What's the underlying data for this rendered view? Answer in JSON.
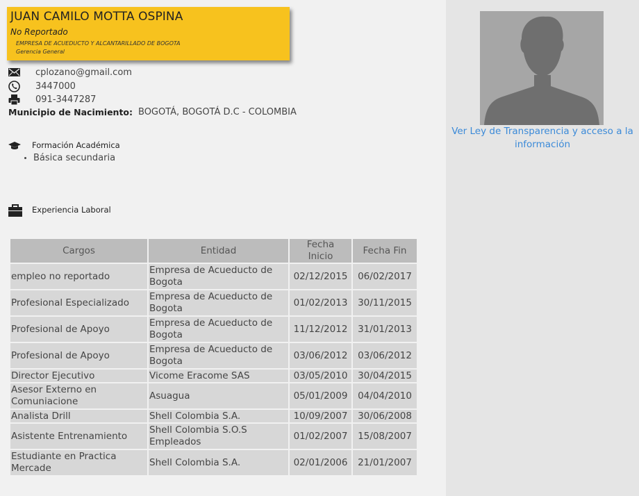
{
  "profile": {
    "name": "JUAN CAMILO MOTTA OSPINA",
    "status": "No Reportado",
    "company": "EMPRESA DE ACUEDUCTO Y ALCANTARILLADO DE BOGOTA",
    "department": "Gerencia General"
  },
  "contact": {
    "email": "cplozano@gmail.com",
    "phone": "3447000",
    "fax": "091-3447287",
    "birthplace_label": "Municipio de Nacimiento:",
    "birthplace_value": "BOGOTÁ, BOGOTÁ D.C - COLOMBIA"
  },
  "education": {
    "title": "Formación Académica",
    "items": [
      "Básica secundaria"
    ]
  },
  "experience": {
    "title": "Experiencia Laboral",
    "headers": [
      "Cargos",
      "Entidad",
      "Fecha Inicio",
      "Fecha Fin"
    ],
    "rows": [
      [
        "empleo no reportado",
        "Empresa de Acueducto de Bogota",
        "02/12/2015",
        "06/02/2017"
      ],
      [
        "Profesional Especializado",
        "Empresa de Acueducto de Bogota",
        "01/02/2013",
        "30/11/2015"
      ],
      [
        "Profesional de Apoyo",
        "Empresa de Acueducto de Bogota",
        "11/12/2012",
        "31/01/2013"
      ],
      [
        "Profesional de Apoyo",
        "Empresa de Acueducto de Bogota",
        "03/06/2012",
        "03/06/2012"
      ],
      [
        "Director Ejecutivo",
        "Vicome Eracome SAS",
        "03/05/2010",
        "30/04/2015"
      ],
      [
        "Asesor Externo en Comuniacione",
        "Asuagua",
        "05/01/2009",
        "04/04/2010"
      ],
      [
        "Analista Drill",
        "Shell Colombia S.A.",
        "10/09/2007",
        "30/06/2008"
      ],
      [
        "Asistente Entrenamiento",
        "Shell Colombia S.O.S Empleados",
        "01/02/2007",
        "15/08/2007"
      ],
      [
        "Estudiante en Practica Mercade",
        "Shell Colombia S.A.",
        "02/01/2006",
        "21/01/2007"
      ]
    ]
  },
  "sidebar": {
    "transparency_link": "Ver Ley de Transparencia y acceso a la información"
  },
  "icons": {
    "email": "envelope-icon",
    "phone": "phone-icon",
    "fax": "printer-icon",
    "education": "graduation-cap-icon",
    "experience": "briefcase-icon",
    "photo": "person-silhouette-icon"
  },
  "colors": {
    "name_card": "#f7c21e",
    "link": "#3b8ad8",
    "table_header": "#bcbcbc",
    "table_cell": "#d7d7d7"
  }
}
